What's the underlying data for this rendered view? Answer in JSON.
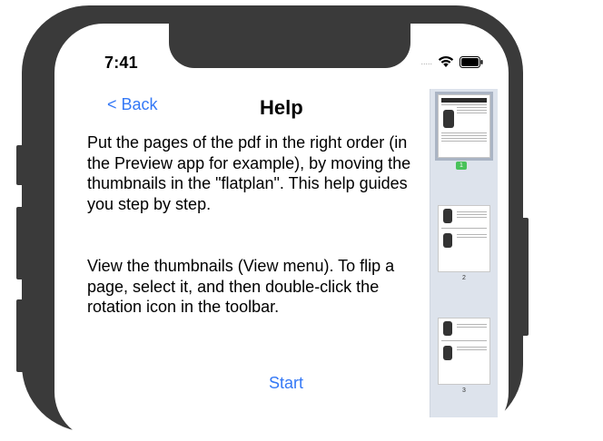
{
  "status_bar": {
    "time": "7:41",
    "signal_dots": ".....",
    "wifi_icon": "wifi-icon",
    "battery_icon": "battery-icon"
  },
  "nav": {
    "back_label": "< Back",
    "title": "Help"
  },
  "content": {
    "paragraph_1": "Put the pages of the pdf in the right order (in the Preview app for example), by moving the thumbnails in the \"flatplan\". This help guides you step by step.",
    "paragraph_2": "View the thumbnails (View menu). To flip a page, select it, and then double-click the rotation icon in the toolbar.",
    "start_label": "Start"
  },
  "thumbnails": [
    {
      "page": "1",
      "selected": true
    },
    {
      "page": "2",
      "selected": false
    },
    {
      "page": "3",
      "selected": false
    }
  ],
  "colors": {
    "accent": "#3478f6",
    "frame": "#3a3a3a",
    "sidebar_bg": "#dde3ec",
    "selected_badge": "#49c25a"
  }
}
